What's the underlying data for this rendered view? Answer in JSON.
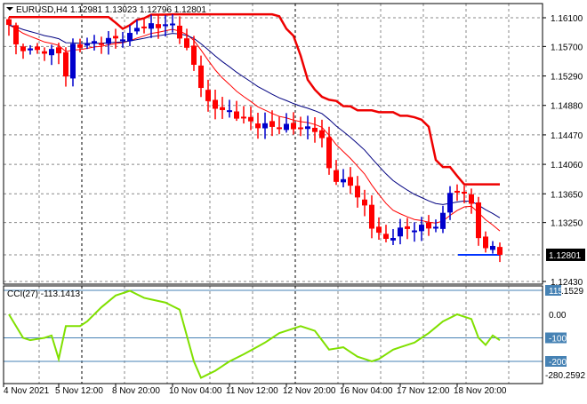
{
  "header": {
    "symbol": "EURUSD,H4",
    "ohlc": "1.12981 1.13023 1.12796 1.12801"
  },
  "cci_header": {
    "label": "CCI(27) -113.1413"
  },
  "chart_data": {
    "type": "candlestick",
    "symbol": "EURUSD",
    "timeframe": "H4",
    "price_axis": {
      "min": 1.1243,
      "max": 1.161,
      "ticks": [
        "1.16100",
        "1.15700",
        "1.15290",
        "1.14880",
        "1.14470",
        "1.14060",
        "1.13650",
        "1.13250",
        "1.12430"
      ],
      "tick_values": [
        1.161,
        1.157,
        1.1529,
        1.1488,
        1.1447,
        1.1406,
        1.1365,
        1.1325,
        1.1243
      ]
    },
    "current_price": {
      "label": "1.12801",
      "value": 1.12801
    },
    "bars": 70,
    "close_keyframes": [
      [
        0,
        1.16
      ],
      [
        1,
        1.157
      ],
      [
        3,
        1.1565
      ],
      [
        7,
        1.1562
      ],
      [
        8,
        1.153
      ],
      [
        9,
        1.157
      ],
      [
        12,
        1.1575
      ],
      [
        17,
        1.1585
      ],
      [
        18,
        1.1598
      ],
      [
        23,
        1.16
      ],
      [
        24,
        1.1585
      ],
      [
        26,
        1.1545
      ],
      [
        27,
        1.1515
      ],
      [
        28,
        1.149
      ],
      [
        31,
        1.1478
      ],
      [
        35,
        1.146
      ],
      [
        40,
        1.1458
      ],
      [
        43,
        1.1455
      ],
      [
        44,
        1.144
      ],
      [
        45,
        1.14
      ],
      [
        46,
        1.1385
      ],
      [
        48,
        1.1378
      ],
      [
        50,
        1.1345
      ],
      [
        51,
        1.132
      ],
      [
        53,
        1.13
      ],
      [
        55,
        1.1315
      ],
      [
        60,
        1.132
      ],
      [
        61,
        1.1335
      ],
      [
        62,
        1.137
      ],
      [
        64,
        1.1365
      ],
      [
        65,
        1.1355
      ],
      [
        66,
        1.13
      ],
      [
        67,
        1.129
      ],
      [
        68,
        1.1295
      ],
      [
        69,
        1.128
      ]
    ],
    "x_labels": [
      "4 Nov 2021",
      "5 Nov 12:00",
      "8 Nov 20:00",
      "10 Nov 04:00",
      "11 Nov 12:00",
      "12 Nov 20:00",
      "16 Nov 04:00",
      "17 Nov 12:00",
      "18 Nov 20:00"
    ],
    "x_label_bars": [
      0,
      7,
      15,
      23,
      31,
      39,
      47,
      55,
      63
    ],
    "cci": {
      "period": 27,
      "range": [
        -280.2592,
        115.1529
      ],
      "range_labels": [
        "115.1529",
        "-280.2592"
      ],
      "levels": [
        100,
        0,
        -100,
        -200
      ],
      "level_labels": [
        "115",
        "0.00",
        "-100",
        "-200"
      ],
      "keyframes": [
        [
          0,
          0
        ],
        [
          2,
          -100
        ],
        [
          3,
          -110
        ],
        [
          5,
          -100
        ],
        [
          6,
          -90
        ],
        [
          7,
          -190
        ],
        [
          8,
          -50
        ],
        [
          10,
          -50
        ],
        [
          11,
          -30
        ],
        [
          13,
          30
        ],
        [
          15,
          80
        ],
        [
          17,
          100
        ],
        [
          19,
          70
        ],
        [
          22,
          50
        ],
        [
          24,
          20
        ],
        [
          26,
          -200
        ],
        [
          27,
          -270
        ],
        [
          29,
          -240
        ],
        [
          31,
          -200
        ],
        [
          33,
          -170
        ],
        [
          36,
          -120
        ],
        [
          38,
          -80
        ],
        [
          41,
          -50
        ],
        [
          43,
          -70
        ],
        [
          45,
          -150
        ],
        [
          47,
          -140
        ],
        [
          49,
          -180
        ],
        [
          51,
          -200
        ],
        [
          52,
          -190
        ],
        [
          54,
          -150
        ],
        [
          57,
          -120
        ],
        [
          59,
          -80
        ],
        [
          61,
          -30
        ],
        [
          63,
          0
        ],
        [
          65,
          -20
        ],
        [
          66,
          -100
        ],
        [
          67,
          -130
        ],
        [
          68,
          -90
        ],
        [
          69,
          -110
        ]
      ]
    },
    "colors": {
      "bull": "#0000cc",
      "bear": "#ff0000",
      "ma_fast": "#ff0000",
      "ma_slow": "#000080",
      "channel": "#ee0000",
      "cci": "#80e000",
      "bid": "#0033ff"
    }
  }
}
